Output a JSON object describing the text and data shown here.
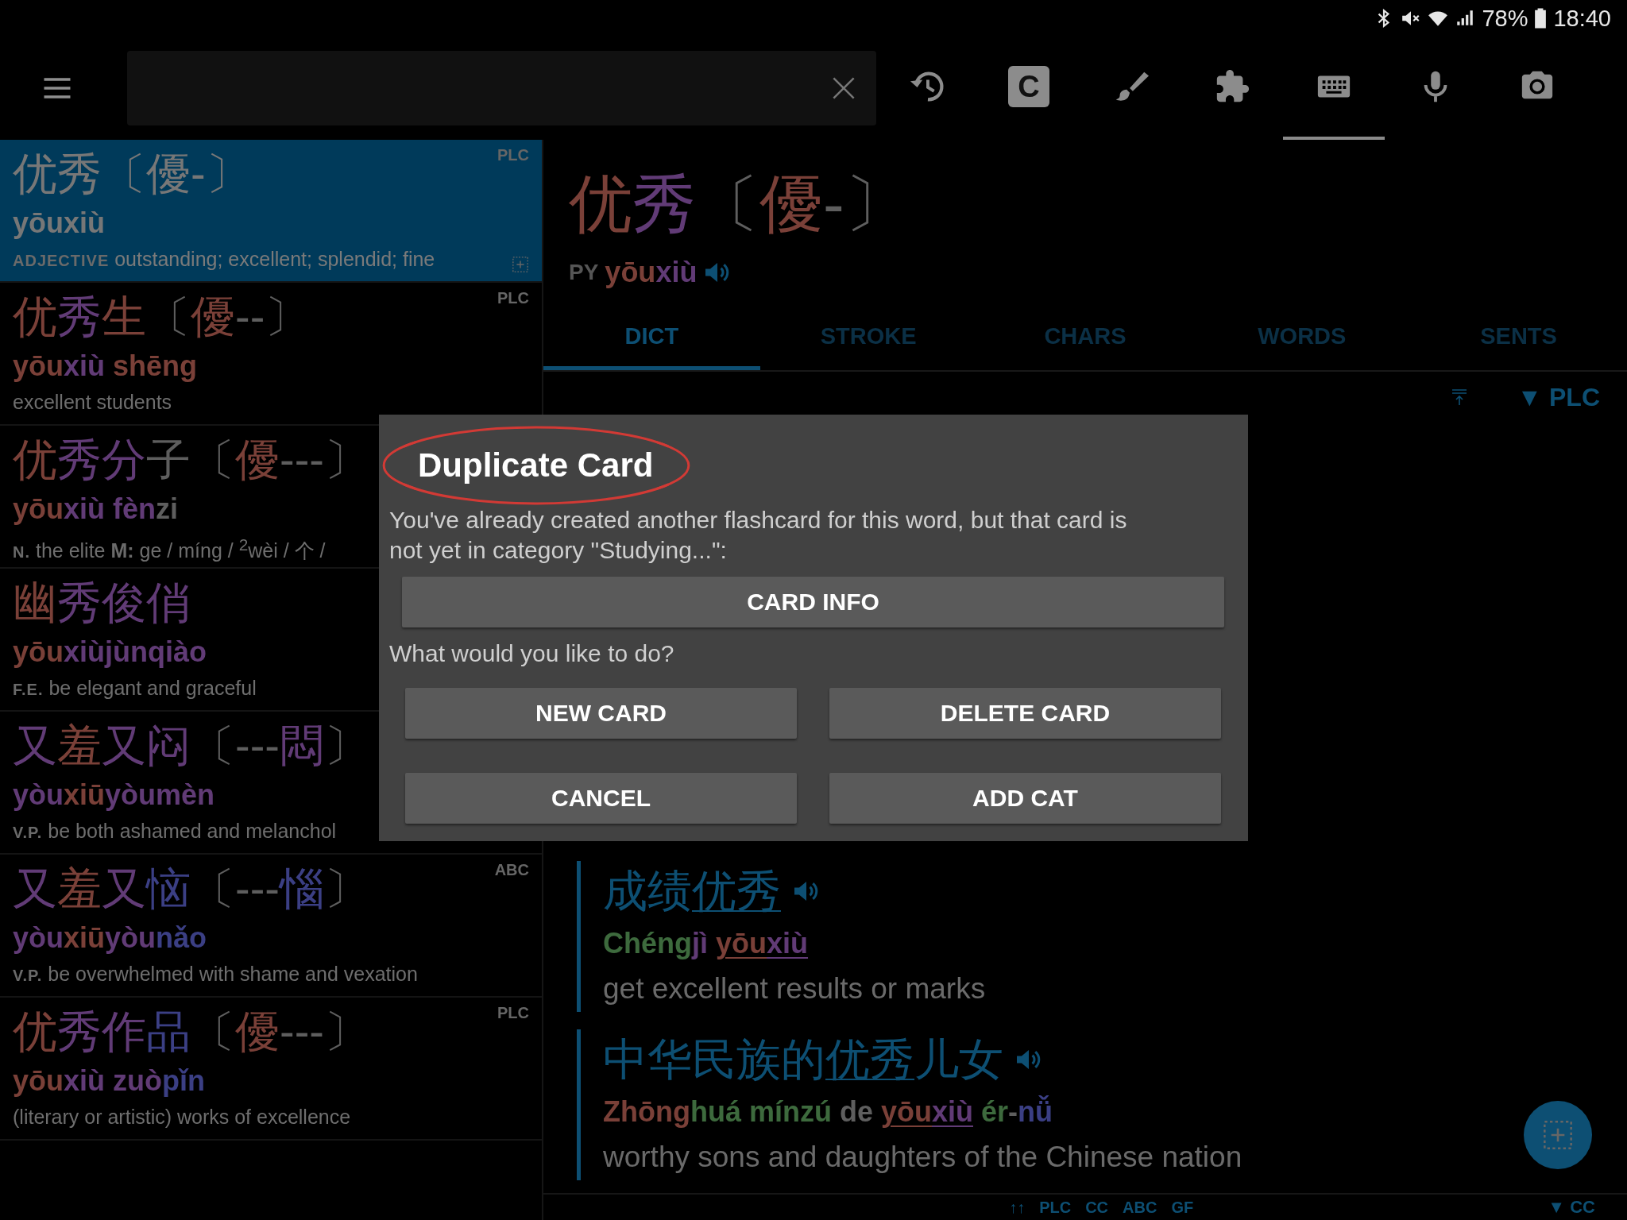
{
  "status_bar": {
    "battery": "78%",
    "time": "18:40"
  },
  "toolbar": {
    "tools": [
      {
        "kind": "history",
        "selected": false
      },
      {
        "kind": "c-box",
        "label": "C",
        "selected": false
      },
      {
        "kind": "brush",
        "selected": false
      },
      {
        "kind": "puzzle",
        "selected": false
      },
      {
        "kind": "keyboard",
        "selected": true
      },
      {
        "kind": "mic",
        "selected": false
      },
      {
        "kind": "camera",
        "selected": false
      }
    ]
  },
  "results": [
    {
      "selected": true,
      "source": "PLC",
      "add_card": true,
      "headword": [
        {
          "text": "优秀〔優-〕",
          "color": "#777777"
        }
      ],
      "pinyin": [
        {
          "text": "yōuxiù",
          "color": "#777777"
        }
      ],
      "pos": "ADJECTIVE",
      "definition": "outstanding; excellent; splendid; fine"
    },
    {
      "selected": false,
      "source": "PLC",
      "add_card": false,
      "headword": [
        {
          "text": "优",
          "color": "#7a4038"
        },
        {
          "text": "秀",
          "color": "#613b76"
        },
        {
          "text": "生",
          "color": "#7a4038"
        },
        {
          "text": "〔",
          "color": "#5e5e5e"
        },
        {
          "text": "優",
          "color": "#7a4038"
        },
        {
          "text": "--〕",
          "color": "#5e5e5e"
        }
      ],
      "pinyin": [
        {
          "text": "yōu",
          "color": "#7a4038"
        },
        {
          "text": "xiù",
          "color": "#613b76"
        },
        {
          "text": " shēng",
          "color": "#7a4038"
        }
      ],
      "definition": "excellent students"
    },
    {
      "selected": false,
      "add_card": false,
      "headword": [
        {
          "text": "优",
          "color": "#7a4038"
        },
        {
          "text": "秀分",
          "color": "#613b76"
        },
        {
          "text": "子〔",
          "color": "#5e5e5e"
        },
        {
          "text": "優",
          "color": "#7a4038"
        },
        {
          "text": "---〕",
          "color": "#5e5e5e"
        }
      ],
      "pinyin": [
        {
          "text": "yōu",
          "color": "#7a4038"
        },
        {
          "text": "xiù fèn",
          "color": "#613b76"
        },
        {
          "text": "zi",
          "color": "#5e5e5e"
        }
      ],
      "pos": "N.",
      "definition": "the elite **M:** ge / míng / $^{2}$wèi / 个 /"
    },
    {
      "selected": false,
      "add_card": false,
      "headword": [
        {
          "text": "幽",
          "color": "#7a4038"
        },
        {
          "text": "秀俊俏",
          "color": "#613b76"
        }
      ],
      "pinyin": [
        {
          "text": "yōu",
          "color": "#7a4038"
        },
        {
          "text": "xiùjùnqiào",
          "color": "#613b76"
        }
      ],
      "pos": "F.E.",
      "definition": "be elegant and graceful"
    },
    {
      "selected": false,
      "add_card": false,
      "headword": [
        {
          "text": "又",
          "color": "#613b76"
        },
        {
          "text": "羞",
          "color": "#7a4038"
        },
        {
          "text": "又闷",
          "color": "#613b76"
        },
        {
          "text": "〔---",
          "color": "#5e5e5e"
        },
        {
          "text": "悶",
          "color": "#613b76"
        },
        {
          "text": "〕",
          "color": "#5e5e5e"
        }
      ],
      "pinyin": [
        {
          "text": "yòu",
          "color": "#613b76"
        },
        {
          "text": "xiū",
          "color": "#7a4038"
        },
        {
          "text": "yòumèn",
          "color": "#613b76"
        }
      ],
      "pos": "V.P.",
      "definition": "be both ashamed and melanchol"
    },
    {
      "selected": false,
      "source": "ABC",
      "add_card": false,
      "headword": [
        {
          "text": "又",
          "color": "#613b76"
        },
        {
          "text": "羞",
          "color": "#7a4038"
        },
        {
          "text": "又",
          "color": "#613b76"
        },
        {
          "text": "恼",
          "color": "#3b3f84"
        },
        {
          "text": "〔---",
          "color": "#5e5e5e"
        },
        {
          "text": "惱",
          "color": "#3b3f84"
        },
        {
          "text": "〕",
          "color": "#5e5e5e"
        }
      ],
      "pinyin": [
        {
          "text": "yòu",
          "color": "#613b76"
        },
        {
          "text": "xiū",
          "color": "#7a4038"
        },
        {
          "text": "yòu",
          "color": "#613b76"
        },
        {
          "text": "nǎo",
          "color": "#3b3f84"
        }
      ],
      "pos": "V.P.",
      "definition": "be overwhelmed with shame and vexation"
    },
    {
      "selected": false,
      "source": "PLC",
      "add_card": false,
      "headword": [
        {
          "text": "优",
          "color": "#7a4038"
        },
        {
          "text": "秀作",
          "color": "#613b76"
        },
        {
          "text": "品",
          "color": "#3b3f84"
        },
        {
          "text": "〔",
          "color": "#5e5e5e"
        },
        {
          "text": "優",
          "color": "#7a4038"
        },
        {
          "text": "---〕",
          "color": "#5e5e5e"
        }
      ],
      "pinyin": [
        {
          "text": "yōu",
          "color": "#7a4038"
        },
        {
          "text": "xiù zuò",
          "color": "#613b76"
        },
        {
          "text": "pǐn",
          "color": "#3b3f84"
        }
      ],
      "definition": "(literary or artistic) works of excellence"
    }
  ],
  "entry": {
    "headword": [
      {
        "text": "优",
        "color": "#7a4038"
      },
      {
        "text": "秀",
        "color": "#613b76"
      },
      {
        "text": "〔",
        "color": "#5e5e5e"
      },
      {
        "text": "優",
        "color": "#7a4038"
      },
      {
        "text": "-〕",
        "color": "#5e5e5e"
      }
    ],
    "py_label": "PY",
    "pinyin": [
      {
        "text": "yōu",
        "color": "#7a4038"
      },
      {
        "text": "xiù",
        "color": "#613b76"
      }
    ],
    "tabs": [
      {
        "label": "DICT",
        "selected": true
      },
      {
        "label": "STROKE",
        "selected": false
      },
      {
        "label": "CHARS",
        "selected": false
      },
      {
        "label": "WORDS",
        "selected": false
      },
      {
        "label": "SENTS",
        "selected": false
      }
    ],
    "source_filter": "▼ PLC",
    "examples": [
      {
        "hanzi": [
          {
            "text": "成绩",
            "underline": false
          },
          {
            "text": "优秀",
            "underline": true
          }
        ],
        "pinyin": [
          {
            "text": "Chéng",
            "color": "#3d6a3d",
            "underline": false
          },
          {
            "text": "jì ",
            "color": "#613b76",
            "underline": false
          },
          {
            "text": "yōu",
            "color": "#7a4038",
            "underline": true
          },
          {
            "text": "xiù",
            "color": "#613b76",
            "underline": true
          }
        ],
        "english": "get excellent results or marks"
      },
      {
        "hanzi": [
          {
            "text": "中华民族的",
            "underline": false
          },
          {
            "text": "优秀",
            "underline": true
          },
          {
            "text": "儿女",
            "underline": false
          }
        ],
        "pinyin": [
          {
            "text": "Zhōng",
            "color": "#7a4038",
            "underline": false
          },
          {
            "text": "huá mínzú",
            "color": "#3d6a3d",
            "underline": false
          },
          {
            "text": " de ",
            "color": "#5e5e5e",
            "underline": false
          },
          {
            "text": "yōu",
            "color": "#7a4038",
            "underline": true
          },
          {
            "text": "xiù",
            "color": "#613b76",
            "underline": true
          },
          {
            "text": " ér",
            "color": "#3d6a3d",
            "underline": false
          },
          {
            "text": "-",
            "color": "#5e5e5e",
            "underline": false
          },
          {
            "text": "nǚ",
            "color": "#3b3f84",
            "underline": false
          }
        ],
        "english": "worthy sons and daughters of the Chinese nation"
      }
    ],
    "footer_sources": [
      "↑↑",
      "PLC",
      "CC",
      "ABC",
      "GF"
    ],
    "footer_filter": "▼ CC"
  },
  "dialog": {
    "title": "Duplicate Card",
    "message": "You've already created another flashcard for this word, but that card is not yet in category \"Studying...\":",
    "info_button": "CARD INFO",
    "question": "What would you like to do?",
    "buttons": [
      "NEW CARD",
      "DELETE CARD",
      "CANCEL",
      "ADD CAT"
    ]
  }
}
